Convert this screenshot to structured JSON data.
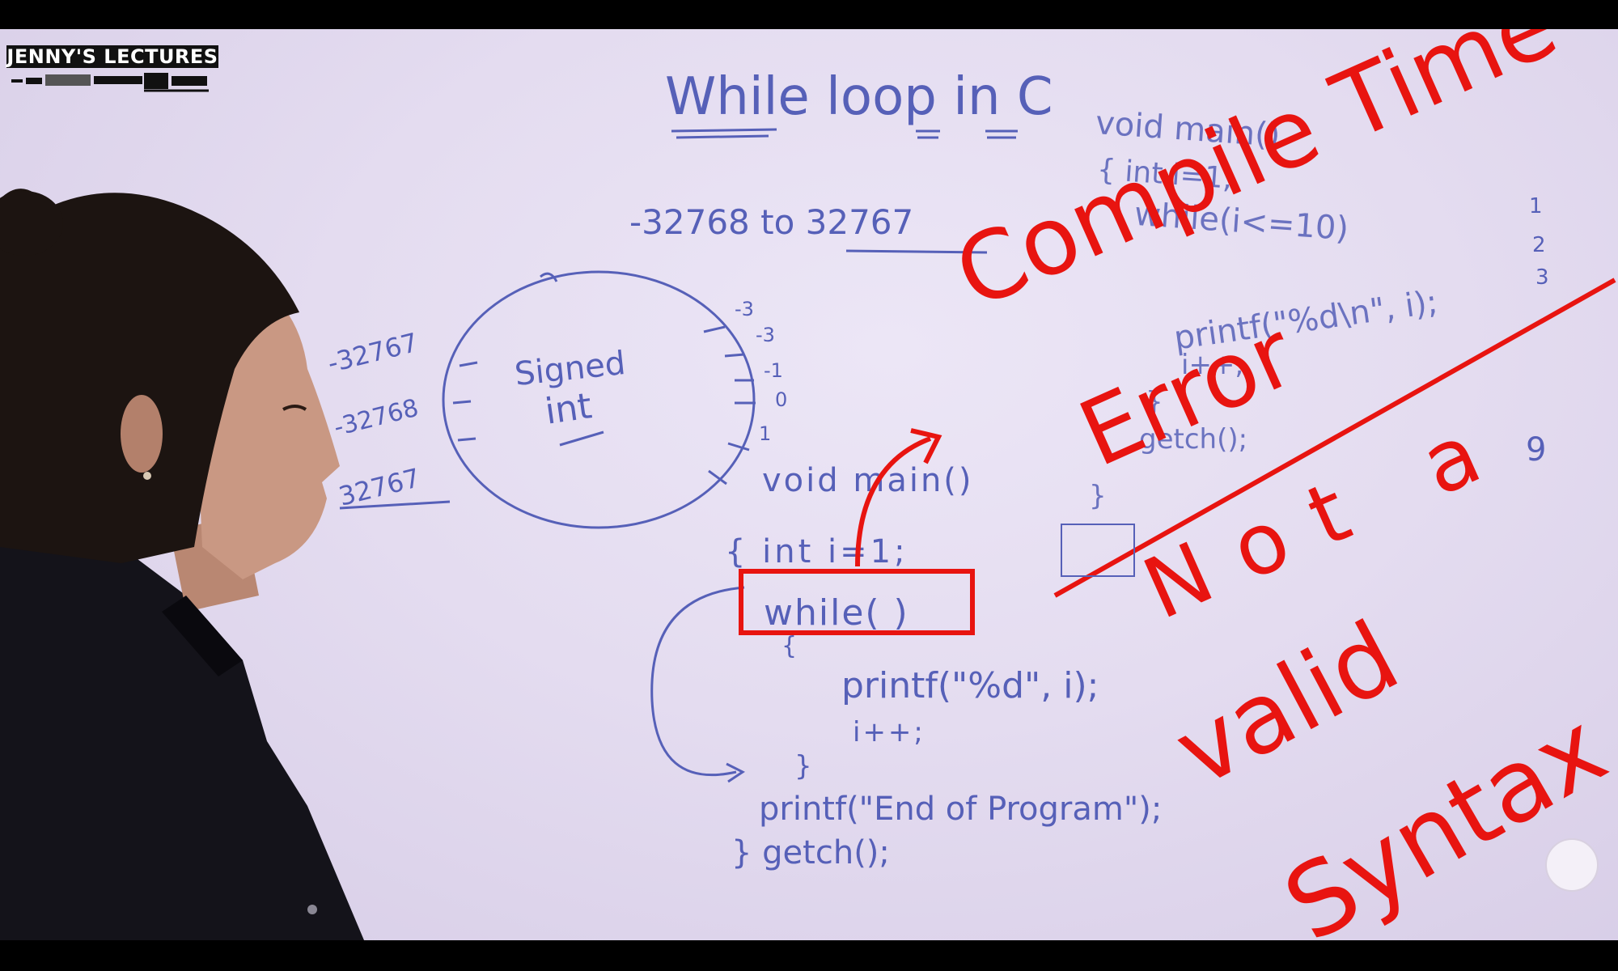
{
  "channel": {
    "logo_text": "JENNY'S LECTURES"
  },
  "whiteboard": {
    "title": "While loop in C",
    "range_text": "-32768 to 32767",
    "circle": {
      "label_line1": "Signed",
      "label_line2": "int",
      "left_values": [
        "-32767",
        "-32768",
        "32767"
      ],
      "right_values": [
        "-3",
        "-3",
        "-1",
        "0",
        "1"
      ]
    },
    "code_main": {
      "line1": "void main()",
      "line2": "{ int i=1;",
      "line3": "while( )",
      "line4": "{",
      "line5": "printf(\"%d\", i);",
      "line6": "i++;",
      "line7": "}",
      "line8": "printf(\"End of Program\");",
      "line9": "} getch();"
    },
    "code_corner": {
      "line1": "void main()",
      "line2": "{ int i=1;",
      "line3": "while(i<=10)",
      "line4": "printf(\"%d\\n\", i);",
      "line5": "i++;",
      "line6": "}",
      "line7": "getch();",
      "line8": "}"
    },
    "output_numbers": [
      "1",
      "2",
      "3",
      "9"
    ],
    "annotation_error": [
      "Compile Time",
      "Error"
    ],
    "annotation_syntax": [
      "Not a",
      "valid",
      "Syntax"
    ]
  },
  "colors": {
    "marker_blue": "#5660b8",
    "marker_red": "#e81410",
    "board": "#e4dcf0"
  }
}
